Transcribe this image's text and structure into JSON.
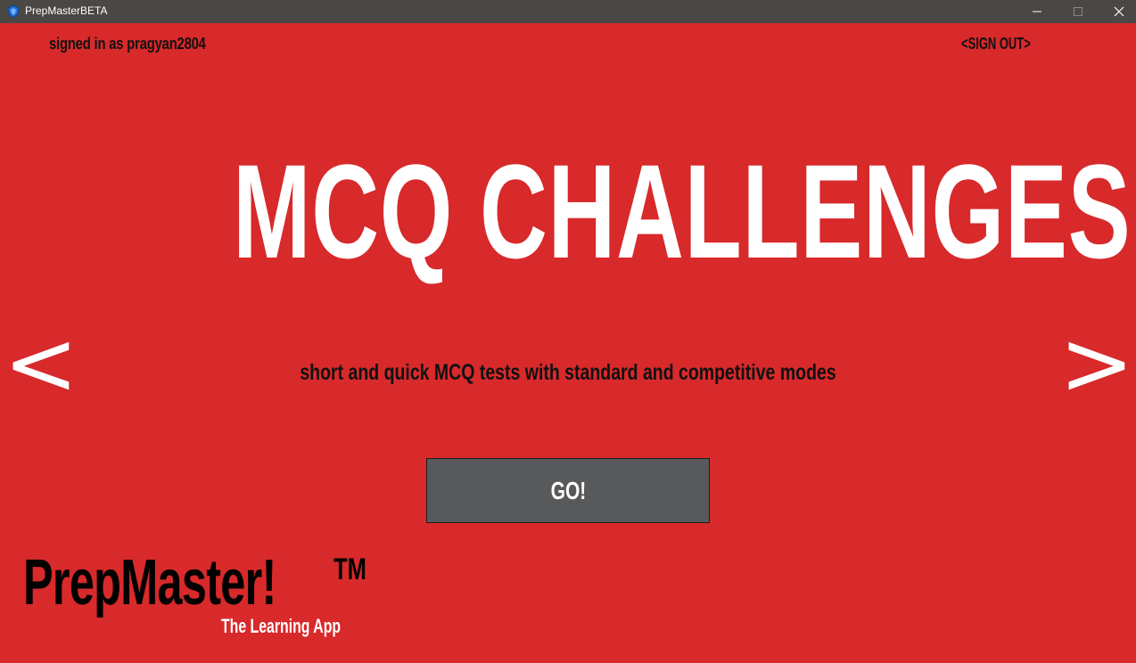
{
  "window": {
    "title": "PrepMasterBETA",
    "icons": [
      "app-icon",
      "minimize-icon",
      "maximize-icon",
      "close-icon"
    ]
  },
  "header": {
    "signed_in_text": "signed in as pragyan2804",
    "sign_out_label": "<SIGN OUT>"
  },
  "carousel": {
    "title": "MCQ CHALLENGES",
    "description": "short and quick MCQ tests with standard and competitive modes",
    "prev_label": "<",
    "next_label": ">",
    "go_label": "GO!"
  },
  "logo": {
    "name": "PrepMaster!",
    "trademark": "TM",
    "tagline": "The Learning App"
  },
  "colors": {
    "background": "#d8292b",
    "titlebar": "#4a4745",
    "button": "#58595b",
    "text_dark": "#111111",
    "text_light": "#ffffff"
  }
}
